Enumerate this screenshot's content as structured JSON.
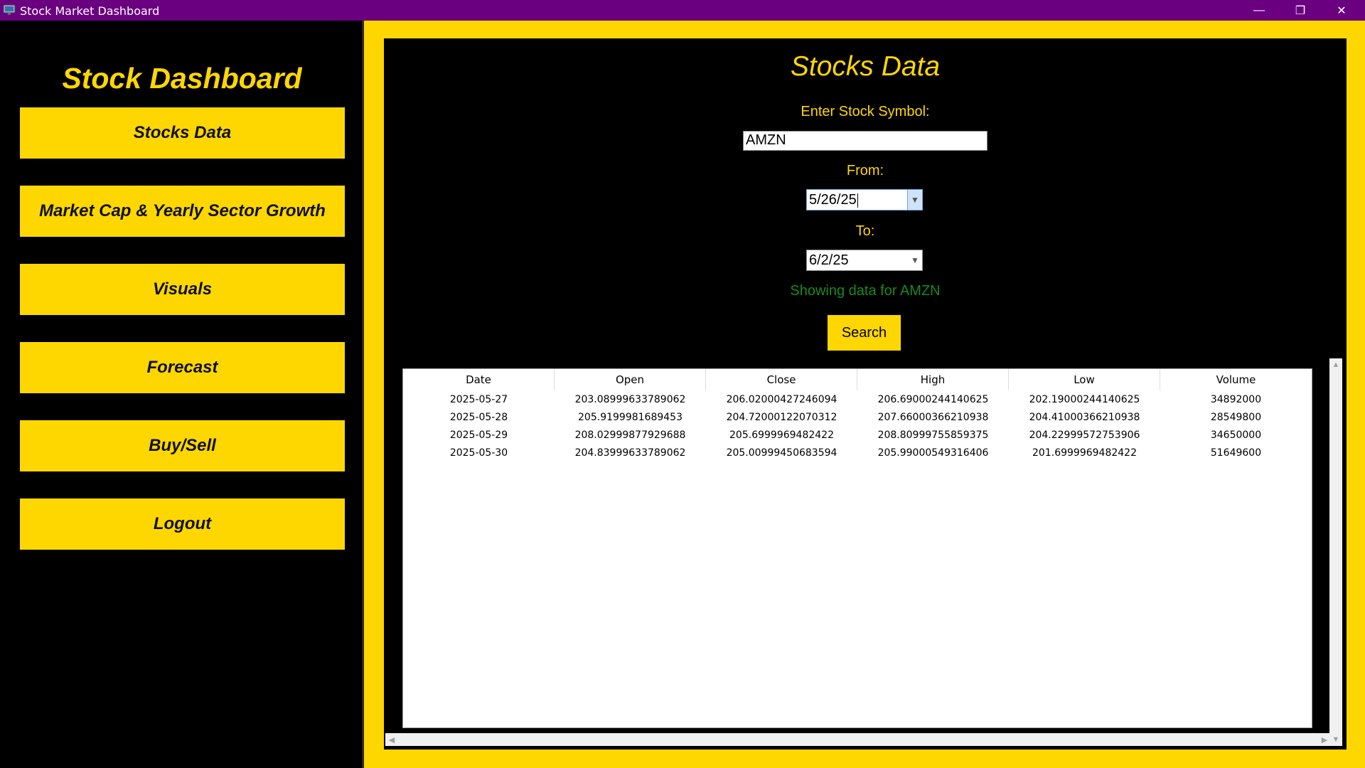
{
  "window": {
    "title": "Stock Market Dashboard",
    "icons": {
      "app": "monitor-icon",
      "minimize": "minimize-icon",
      "maximize": "restore-icon",
      "close": "close-icon"
    },
    "controls": {
      "minimize": "—",
      "maximize": "❐",
      "close": "✕"
    }
  },
  "sidebar": {
    "title": "Stock Dashboard",
    "items": [
      {
        "label": "Stocks Data"
      },
      {
        "label": "Market Cap & Yearly Sector Growth"
      },
      {
        "label": "Visuals"
      },
      {
        "label": "Forecast"
      },
      {
        "label": "Buy/Sell"
      },
      {
        "label": "Logout"
      }
    ]
  },
  "main": {
    "title": "Stocks Data",
    "symbol_label": "Enter Stock Symbol:",
    "symbol_value": "AMZN",
    "from_label": "From:",
    "from_value": "5/26/25",
    "to_label": "To:",
    "to_value": "6/2/25",
    "status": "Showing data for AMZN",
    "search_label": "Search"
  },
  "table": {
    "columns": [
      "Date",
      "Open",
      "Close",
      "High",
      "Low",
      "Volume"
    ],
    "rows": [
      [
        "2025-05-27",
        "203.08999633789062",
        "206.02000427246094",
        "206.69000244140625",
        "202.19000244140625",
        "34892000"
      ],
      [
        "2025-05-28",
        "205.9199981689453",
        "204.72000122070312",
        "207.66000366210938",
        "204.41000366210938",
        "28549800"
      ],
      [
        "2025-05-29",
        "208.02999877929688",
        "205.6999969482422",
        "208.80999755859375",
        "204.22999572753906",
        "34650000"
      ],
      [
        "2025-05-30",
        "204.83999633789062",
        "205.00999450683594",
        "205.99000549316406",
        "201.6999969482422",
        "51649600"
      ]
    ]
  },
  "colors": {
    "accent": "#ffd700",
    "titlebar": "#6a0080",
    "background": "#000000",
    "status_text": "#1a8a1a"
  }
}
